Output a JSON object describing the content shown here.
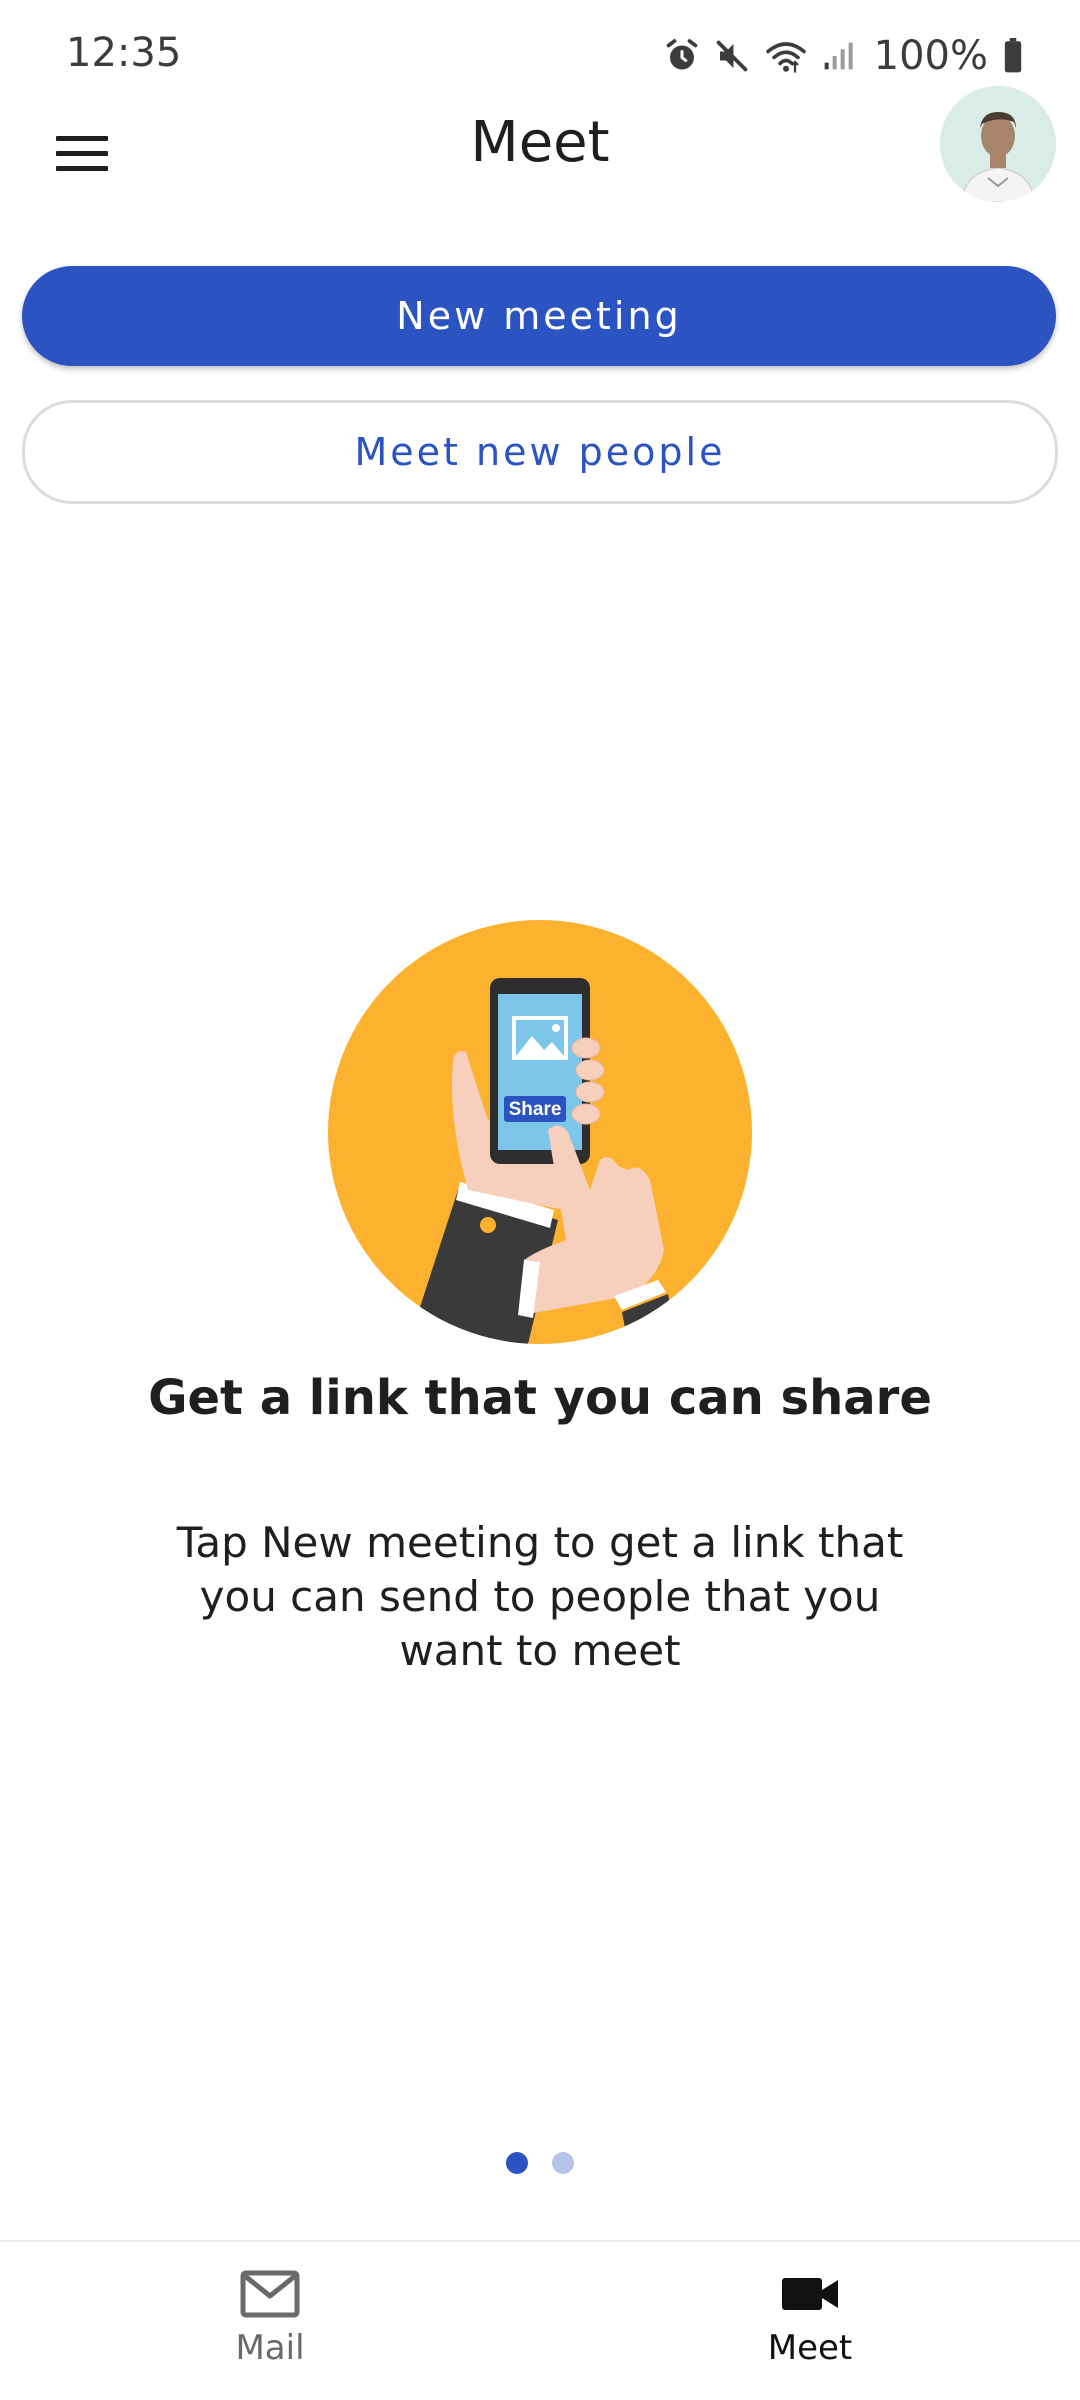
{
  "status_bar": {
    "time": "12:35",
    "battery": "100%",
    "icons": [
      "alarm-icon",
      "mute-icon",
      "wifi-icon",
      "signal-icon",
      "battery-icon"
    ]
  },
  "app_bar": {
    "title": "Meet",
    "menu_icon": "hamburger-menu-icon",
    "avatar": "profile-avatar"
  },
  "actions": {
    "new_meeting": "New meeting",
    "meet_new_people": "Meet new people"
  },
  "onboarding": {
    "illustration_label": "Share",
    "title": "Get a link that you can share",
    "body": "Tap New meeting to get a link that you can send to people that you want to meet",
    "pages": 2,
    "active_page": 1
  },
  "bottom_nav": {
    "items": [
      {
        "label": "Mail",
        "icon": "mail-icon",
        "selected": false
      },
      {
        "label": "Meet",
        "icon": "video-camera-icon",
        "selected": true
      }
    ]
  },
  "colors": {
    "primary": "#2b53c2",
    "illustration_bg": "#fdb22f",
    "dot_inactive": "#b6c3ea"
  }
}
